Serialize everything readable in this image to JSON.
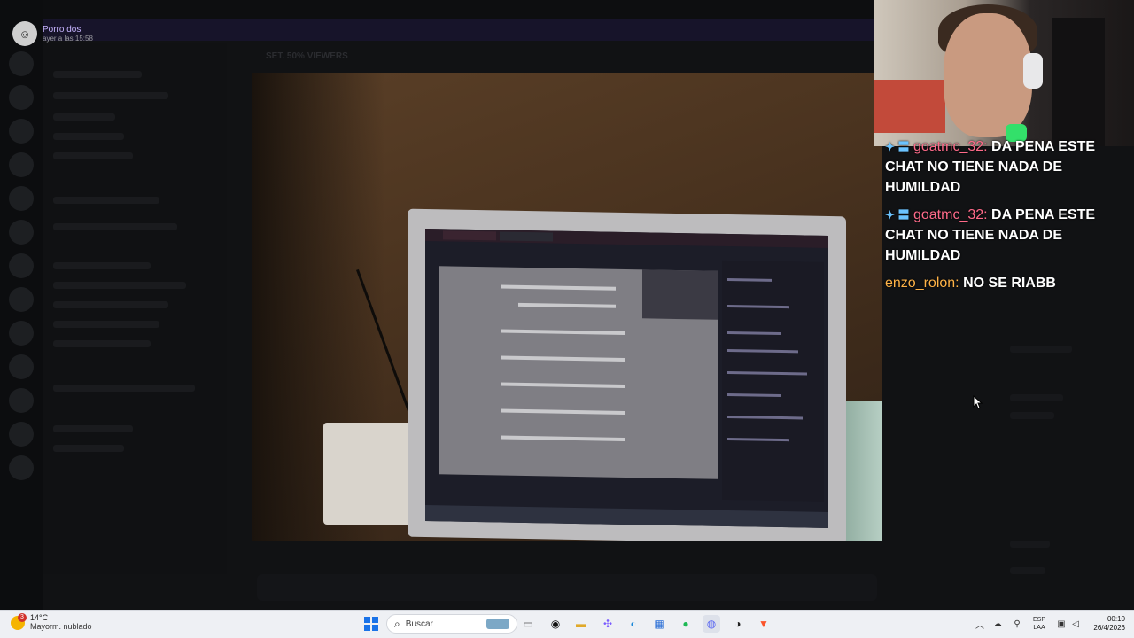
{
  "notification": {
    "user": "Porro dos",
    "time": "ayer a las 15:58"
  },
  "discord_background": {
    "channel_header": "SET. 50% VIEWERS"
  },
  "chat": {
    "messages": [
      {
        "badges": "✦ 〓",
        "user": "goatmc_32:",
        "user_color": "#ff6b8a",
        "text": "DA PENA ESTE CHAT NO TIENE NADA DE HUMILDAD"
      },
      {
        "badges": "✦ 〓",
        "user": "goatmc_32:",
        "user_color": "#ff6b8a",
        "text": "DA PENA ESTE CHAT NO TIENE NADA DE HUMILDAD"
      },
      {
        "badges": "",
        "user": "enzo_rolon:",
        "user_color": "#ffb347",
        "text": "NO SE RIABB"
      }
    ]
  },
  "taskbar": {
    "weather": {
      "temp": "14°C",
      "condition": "Mayorm. nublado",
      "badge": "3"
    },
    "search_placeholder": "Buscar",
    "start_icon": "windows-start-icon",
    "apps": [
      {
        "name": "file-explorer-icon",
        "glyph": "▭",
        "color": "#555"
      },
      {
        "name": "obs-icon",
        "glyph": "◉",
        "color": "#111"
      },
      {
        "name": "folder-icon",
        "glyph": "▬",
        "color": "#f2c14e"
      },
      {
        "name": "copilot-icon",
        "glyph": "✣",
        "color": "#7b5cff"
      },
      {
        "name": "edge-icon",
        "glyph": "◐",
        "color": "#1b88d8"
      },
      {
        "name": "store-icon",
        "glyph": "▦",
        "color": "#2b6fd6"
      },
      {
        "name": "spotify-icon",
        "glyph": "●",
        "color": "#1db954"
      },
      {
        "name": "discord-icon",
        "glyph": "◍",
        "color": "#5865f2"
      },
      {
        "name": "obs-studio-icon",
        "glyph": "◑",
        "color": "#222"
      },
      {
        "name": "brave-icon",
        "glyph": "▼",
        "color": "#fb542b"
      }
    ],
    "language": {
      "line1": "ESP",
      "line2": "LAA"
    },
    "clock": {
      "time": "00:10",
      "date": "26/4/2026"
    }
  }
}
